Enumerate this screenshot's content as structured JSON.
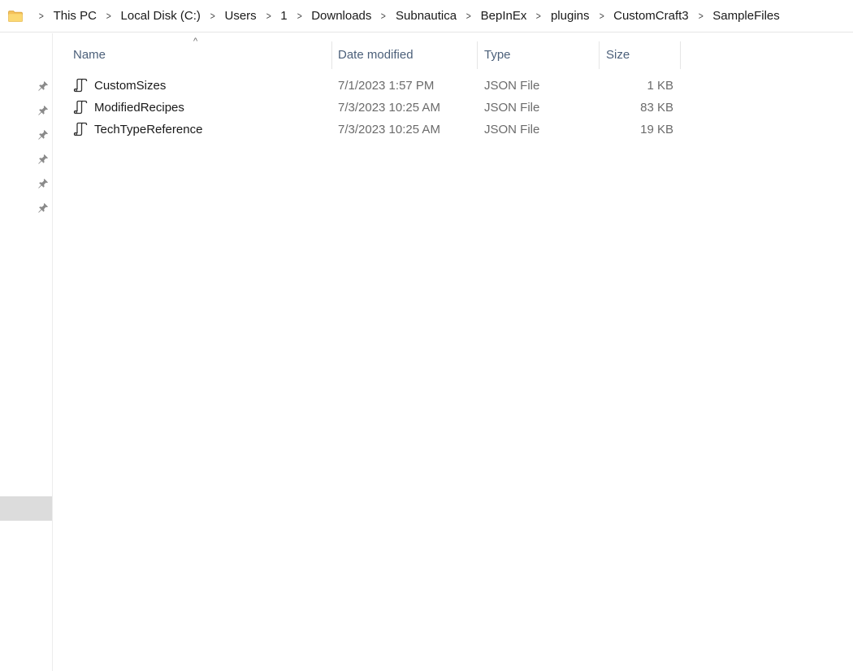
{
  "breadcrumb": {
    "icon": "folder-icon",
    "items": [
      "This PC",
      "Local Disk (C:)",
      "Users",
      "1",
      "Downloads",
      "Subnautica",
      "BepInEx",
      "plugins",
      "CustomCraft3",
      "SampleFiles"
    ]
  },
  "nav_pane": {
    "pin_icon": "pin-icon",
    "pin_count": 6
  },
  "columns": {
    "name": "Name",
    "date_modified": "Date modified",
    "type": "Type",
    "size": "Size",
    "sort_indicator": "^"
  },
  "files": [
    {
      "name": "CustomSizes",
      "date": "7/1/2023 1:57 PM",
      "type": "JSON File",
      "size": "1 KB",
      "icon": "json-file-icon"
    },
    {
      "name": "ModifiedRecipes",
      "date": "7/3/2023 10:25 AM",
      "type": "JSON File",
      "size": "83 KB",
      "icon": "json-file-icon"
    },
    {
      "name": "TechTypeReference",
      "date": "7/3/2023 10:25 AM",
      "type": "JSON File",
      "size": "19 KB",
      "icon": "json-file-icon"
    }
  ],
  "colors": {
    "folder": "#f4c15a",
    "header_text": "#4c607a",
    "secondary_text": "#6b6b6b",
    "nav_selected": "#dcdcdc"
  }
}
